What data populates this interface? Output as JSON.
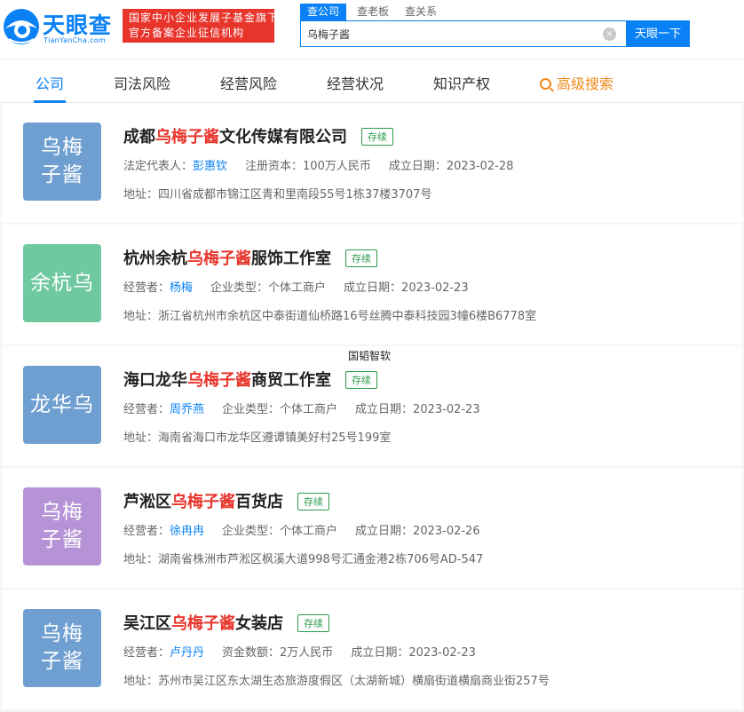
{
  "header": {
    "logo_text": "天眼查",
    "logo_sub": "TianYanCha.com",
    "badge_line1": "国家中小企业发展子基金旗下",
    "badge_line2": "官方备案企业征信机构",
    "search_tabs": [
      "查公司",
      "查老板",
      "查关系"
    ],
    "search_value": "乌梅子酱",
    "clear_icon": "×",
    "search_button": "天眼一下"
  },
  "nav": {
    "items": [
      "公司",
      "司法风险",
      "经营风险",
      "经营状况",
      "知识产权"
    ],
    "advanced": "高级搜索"
  },
  "floating_label": "国韬智软",
  "results": [
    {
      "avatar": "乌梅子酱",
      "avatar_color": "#6f9fd0",
      "name_prefix": "成都",
      "name_hl": "乌梅子酱",
      "name_suffix": "文化传媒有限公司",
      "status": "存续",
      "person_label": "法定代表人：",
      "person": "彭惠钦",
      "field2": "注册资本：100万人民币",
      "date": "成立日期：2023-02-28",
      "address": "地址：四川省成都市锦江区青和里南段55号1栋37楼3707号"
    },
    {
      "avatar": "余杭乌",
      "avatar_color": "#6fc9a0",
      "name_prefix": "杭州余杭",
      "name_hl": "乌梅子酱",
      "name_suffix": "服饰工作室",
      "status": "存续",
      "person_label": "经营者：",
      "person": "杨梅",
      "field2": "企业类型：个体工商户",
      "date": "成立日期：2023-02-23",
      "address": "地址：浙江省杭州市余杭区中泰街道仙桥路16号丝腾中泰科技园3幢6楼B6778室"
    },
    {
      "avatar": "龙华乌",
      "avatar_color": "#6f9fd0",
      "name_prefix": "海口龙华",
      "name_hl": "乌梅子酱",
      "name_suffix": "商贸工作室",
      "status": "存续",
      "person_label": "经营者：",
      "person": "周乔燕",
      "field2": "企业类型：个体工商户",
      "date": "成立日期：2023-02-23",
      "address": "地址：海南省海口市龙华区遵谭镇美好村25号199室"
    },
    {
      "avatar": "乌梅子酱",
      "avatar_color": "#b593d6",
      "name_prefix": "芦淞区",
      "name_hl": "乌梅子酱",
      "name_suffix": "百货店",
      "status": "存续",
      "person_label": "经营者：",
      "person": "徐冉冉",
      "field2": "企业类型：个体工商户",
      "date": "成立日期：2023-02-26",
      "address": "地址：湖南省株洲市芦淞区枫溪大道998号汇通金港2栋706号AD-547"
    },
    {
      "avatar": "乌梅子酱",
      "avatar_color": "#6f9fd0",
      "name_prefix": "吴江区",
      "name_hl": "乌梅子酱",
      "name_suffix": "女装店",
      "status": "存续",
      "person_label": "经营者：",
      "person": "卢丹丹",
      "field2": "资金数额：2万人民币",
      "date": "成立日期：2023-02-23",
      "address": "地址：苏州市吴江区东太湖生态旅游度假区（太湖新城）横扇街道横扇商业街257号"
    }
  ]
}
